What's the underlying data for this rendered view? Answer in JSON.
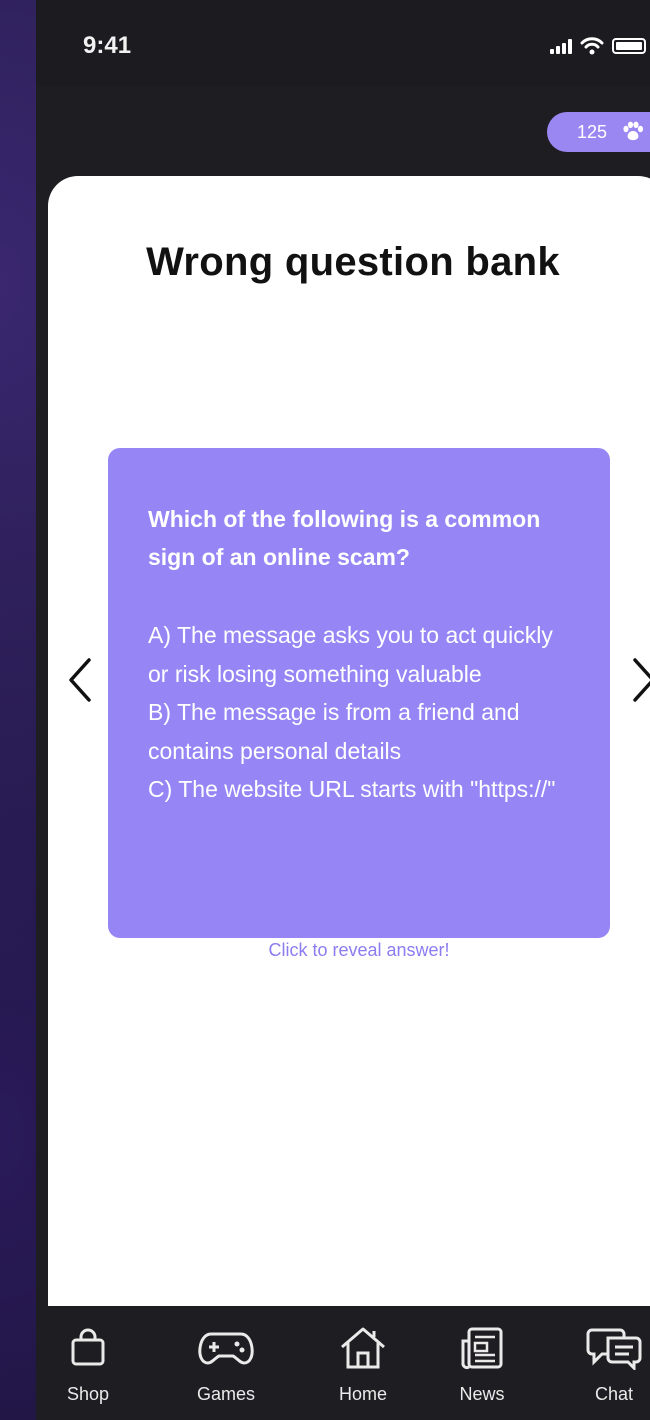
{
  "status_bar": {
    "time": "9:41"
  },
  "points": {
    "value": "125",
    "icon": "paw-icon"
  },
  "page": {
    "title": "Wrong question bank"
  },
  "flashcard": {
    "question": "Which of the following is a common sign of an online scam?",
    "options": [
      "A) The message asks you to act quickly or risk losing something valuable",
      "B) The message is from a friend and contains personal details",
      "C) The website URL starts with \"https://\""
    ]
  },
  "reveal_label": "Click to reveal answer!",
  "nav": {
    "items": [
      {
        "label": "Shop",
        "icon": "shopping-bag-icon"
      },
      {
        "label": "Games",
        "icon": "gamepad-icon"
      },
      {
        "label": "Home",
        "icon": "home-icon"
      },
      {
        "label": "News",
        "icon": "newspaper-icon"
      },
      {
        "label": "Chat",
        "icon": "chat-icon"
      }
    ]
  },
  "colors": {
    "accent": "#9685f4",
    "pill": "#9b87f2",
    "reveal_text": "#8b7cf0",
    "dark_bg": "#1e1e22"
  }
}
